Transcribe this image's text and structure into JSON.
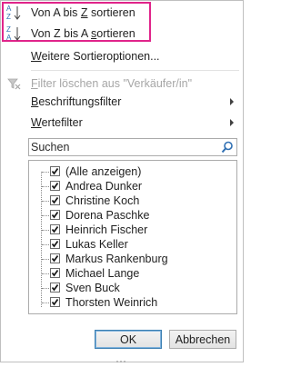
{
  "menu": {
    "sort_az": {
      "before": "Von A bis ",
      "accel": "Z",
      "after": " sortieren",
      "icon": "sort-ascending-icon"
    },
    "sort_za": {
      "before": "Von Z bis A ",
      "accel": "s",
      "after": "ortieren",
      "icon": "sort-descending-icon"
    },
    "more_sort": {
      "accel": "W",
      "rest": "eitere Sortieroptionen..."
    },
    "clear_filter": {
      "accel": "F",
      "rest": "ilter löschen aus \"Verkäufer/in\"",
      "icon": "clear-filter-icon"
    },
    "label_filter": {
      "accel": "B",
      "rest": "eschriftungsfilter"
    },
    "value_filter": {
      "accel": "W",
      "rest": "ertefilter"
    }
  },
  "search": {
    "placeholder": "Suchen",
    "value": "",
    "icon": "search-icon"
  },
  "list": {
    "items": [
      {
        "label": "(Alle anzeigen)",
        "checked": true
      },
      {
        "label": "Andrea Dunker",
        "checked": true
      },
      {
        "label": "Christine Koch",
        "checked": true
      },
      {
        "label": "Dorena Paschke",
        "checked": true
      },
      {
        "label": "Heinrich Fischer",
        "checked": true
      },
      {
        "label": "Lukas Keller",
        "checked": true
      },
      {
        "label": "Markus Rankenburg",
        "checked": true
      },
      {
        "label": "Michael Lange",
        "checked": true
      },
      {
        "label": "Sven Buck",
        "checked": true
      },
      {
        "label": "Thorsten Weinrich",
        "checked": true
      }
    ]
  },
  "buttons": {
    "ok": "OK",
    "cancel": "Abbrechen"
  },
  "colors": {
    "highlight": "#e0248a",
    "sort_letters_blue": "#2f6fb3"
  }
}
